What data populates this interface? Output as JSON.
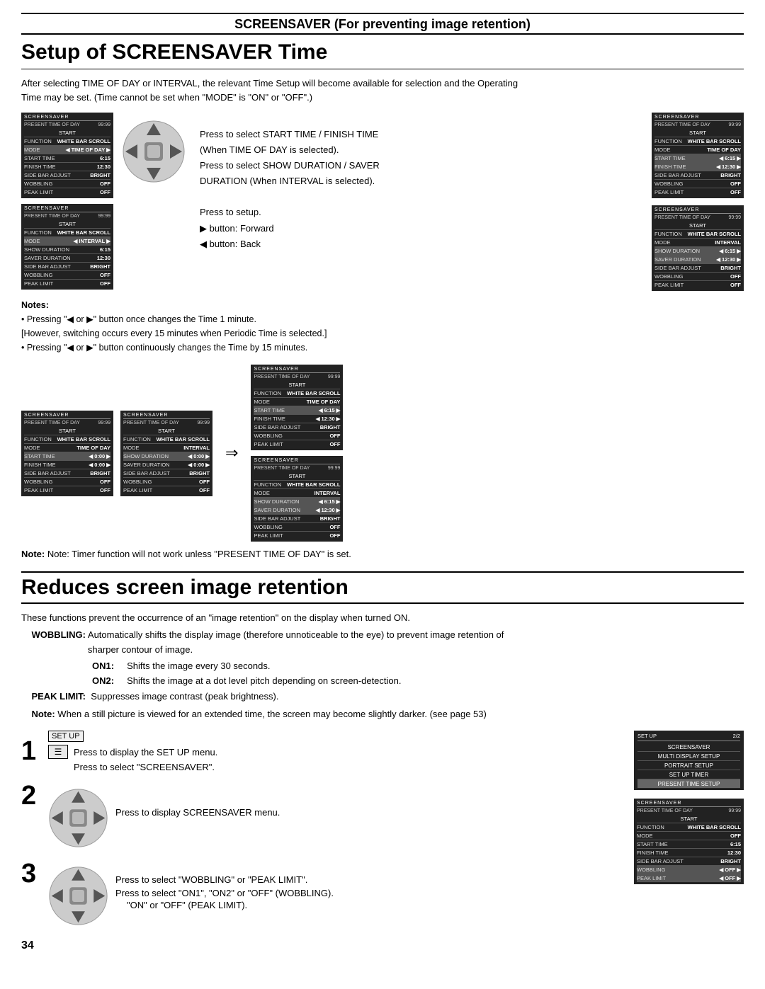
{
  "header": {
    "title": "SCREENSAVER (For preventing image retention)"
  },
  "setup_section": {
    "title": "Setup of SCREENSAVER Time",
    "intro1": "After selecting TIME OF DAY or INTERVAL, the relevant Time Setup will become available for selection and the Operating",
    "intro2": "Time may be set. (Time cannot be set when \"MODE\" is \"ON\" or \"OFF\".)",
    "note_timer": "Note: Timer function will not work unless \"PRESENT TIME OF DAY\" is set."
  },
  "dpad_instructions": {
    "line1": "Press to select START TIME / FINISH TIME",
    "line2": "(When TIME OF DAY is selected).",
    "line3": "Press to select SHOW DURATION / SAVER",
    "line4": "DURATION (When INTERVAL is selected).",
    "line5": "Press to setup.",
    "line6": "▶ button: Forward",
    "line7": "◀ button: Back"
  },
  "notes": {
    "title": "Notes:",
    "bullet1": "• Pressing \"◀ or ▶\" button once changes the Time 1 minute.",
    "bullet2": "[However, switching occurs every 15 minutes when Periodic Time is selected.]",
    "bullet3": "• Pressing \"◀ or ▶\" button continuously changes the Time by 15 minutes."
  },
  "reduces_section": {
    "title": "Reduces screen image retention",
    "intro": "These functions prevent the occurrence of an \"image retention\" on the display when turned ON.",
    "wobbling_label": "WOBBLING:",
    "wobbling_text": "Automatically shifts the display image (therefore unnoticeable to the eye) to prevent image retention of",
    "wobbling_text2": "sharper contour of image.",
    "on1_label": "ON1:",
    "on1_text": "Shifts the image every 30 seconds.",
    "on2_label": "ON2:",
    "on2_text": "Shifts the image at a dot level pitch depending on screen-detection.",
    "peak_label": "PEAK LIMIT:",
    "peak_text": "Suppresses image contrast (peak brightness).",
    "note_still": "Note:",
    "note_still_text": "When a still picture is viewed for an extended time, the screen may become slightly darker. (see page 53)"
  },
  "steps": {
    "step1_num": "1",
    "step2_num": "2",
    "step3_num": "3",
    "setup_label": "SET UP",
    "press1": "Press to display the SET UP menu.",
    "press2": "Press to select \"SCREENSAVER\".",
    "press3": "Press to display SCREENSAVER menu.",
    "press4": "Press to select \"WOBBLING\" or \"PEAK LIMIT\".",
    "press5": "Press to select \"ON1\", \"ON2\" or \"OFF\" (WOBBLING).",
    "press6": "\"ON\" or \"OFF\" (PEAK LIMIT)."
  },
  "page_number": "34",
  "screensaver_boxes": {
    "title": "SCREENSAVER",
    "present_label": "PRESENT TIME OF DAY",
    "present_val": "99:99",
    "start_label": "START",
    "rows_timeofday": [
      {
        "label": "FUNCTION",
        "val": "WHITE BAR SCROLL"
      },
      {
        "label": "MODE",
        "val": "TIME OF DAY",
        "arrow": true
      },
      {
        "label": "START TIME",
        "val": "6:15"
      },
      {
        "label": "FINISH TIME",
        "val": "12:30"
      },
      {
        "label": "SIDE BAR ADJUST",
        "val": "BRIGHT"
      },
      {
        "label": "WOBBLING",
        "val": "OFF"
      },
      {
        "label": "PEAK LIMIT",
        "val": "OFF"
      }
    ],
    "rows_interval": [
      {
        "label": "FUNCTION",
        "val": "WHITE BAR SCROLL"
      },
      {
        "label": "MODE",
        "val": "INTERVAL",
        "arrow": true
      },
      {
        "label": "SHOW DURATION",
        "val": "6:15"
      },
      {
        "label": "SAVER DURATION",
        "val": "12:30"
      },
      {
        "label": "SIDE BAR ADJUST",
        "val": "BRIGHT"
      },
      {
        "label": "WOBBLING",
        "val": "OFF"
      },
      {
        "label": "PEAK LIMIT",
        "val": "OFF"
      }
    ],
    "rows_timeofday_sel": [
      {
        "label": "FUNCTION",
        "val": "WHITE BAR SCROLL"
      },
      {
        "label": "MODE",
        "val": "TIME OF DAY"
      },
      {
        "label": "START TIME",
        "val": "6:15",
        "arrow": true
      },
      {
        "label": "FINISH TIME",
        "val": "12:30",
        "arrow": true
      },
      {
        "label": "SIDE BAR ADJUST",
        "val": "BRIGHT"
      },
      {
        "label": "WOBBLING",
        "val": "OFF"
      },
      {
        "label": "PEAK LIMIT",
        "val": "OFF"
      }
    ],
    "rows_interval_sel": [
      {
        "label": "FUNCTION",
        "val": "WHITE BAR SCROLL"
      },
      {
        "label": "MODE",
        "val": "INTERVAL"
      },
      {
        "label": "SHOW DURATION",
        "val": "6:15",
        "arrow": true
      },
      {
        "label": "SAVER DURATION",
        "val": "12:30",
        "arrow": true
      },
      {
        "label": "SIDE BAR ADJUST",
        "val": "BRIGHT"
      },
      {
        "label": "WOBBLING",
        "val": "OFF"
      },
      {
        "label": "PEAK LIMIT",
        "val": "OFF"
      }
    ]
  },
  "setup_menu": {
    "title": "SET UP",
    "page": "2/2",
    "items": [
      "SCREENSAVER",
      "MULTI DISPLAY SETUP",
      "PORTRAIT SETUP",
      "SET UP TIMER",
      "PRESENT TIME SETUP"
    ],
    "highlighted": "PRESENT TIME SETUP"
  }
}
